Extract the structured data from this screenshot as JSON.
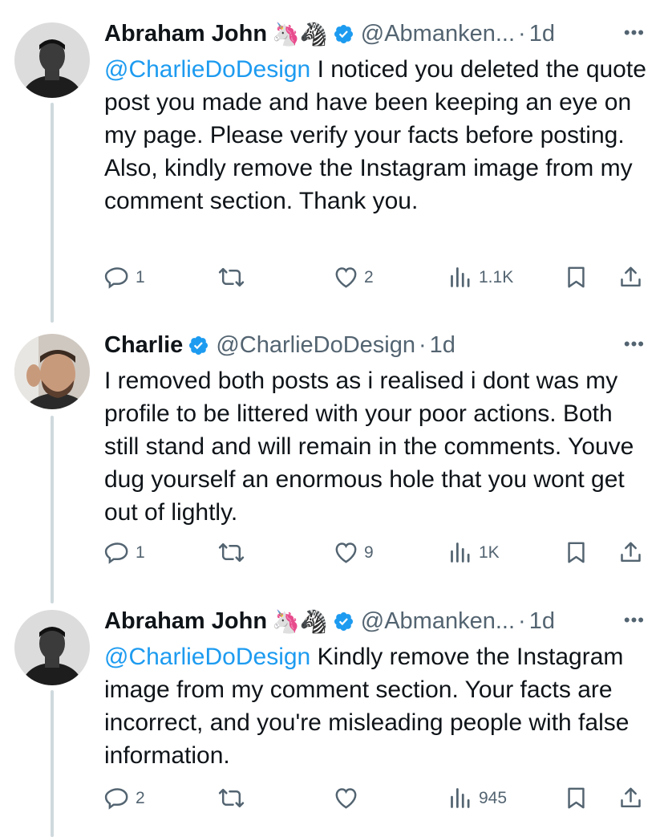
{
  "tweets": [
    {
      "name": "Abraham John",
      "emojis": "🦄🦓",
      "handle": "@Abmanken...",
      "dot": "·",
      "time": "1d",
      "more": "•••",
      "mention": "@CharlieDoDesign",
      "body": " I noticed you deleted the quote post you made and have been keeping an eye on my page. Please verify your facts before posting. Also, kindly remove the Instagram image from my comment section. Thank you.",
      "replies": "1",
      "reposts": "",
      "likes": "2",
      "views": "1.1K"
    },
    {
      "name": "Charlie",
      "emojis": "",
      "handle": "@CharlieDoDesign",
      "dot": "·",
      "time": "1d",
      "more": "•••",
      "mention": "",
      "body": "I removed both posts as i realised i dont was my profile to be littered with your poor actions. Both still stand and will remain in the comments. Youve dug yourself an enormous hole that you wont get out of lightly.",
      "replies": "1",
      "reposts": "",
      "likes": "9",
      "views": "1K"
    },
    {
      "name": "Abraham John",
      "emojis": "🦄🦓",
      "handle": "@Abmanken...",
      "dot": "·",
      "time": "1d",
      "more": "•••",
      "mention": "@CharlieDoDesign",
      "body": " Kindly remove the Instagram image from my comment section. Your facts are incorrect, and you're misleading people with false information.",
      "replies": "2",
      "reposts": "",
      "likes": "",
      "views": "945"
    }
  ],
  "icons": {
    "reply": "reply-icon",
    "repost": "repost-icon",
    "like": "heart-icon",
    "views": "views-icon",
    "bookmark": "bookmark-icon",
    "share": "share-icon",
    "verified": "verified-badge-icon"
  },
  "colors": {
    "accent": "#1d9bf0",
    "secondary": "#536471",
    "text": "#0f1419"
  }
}
